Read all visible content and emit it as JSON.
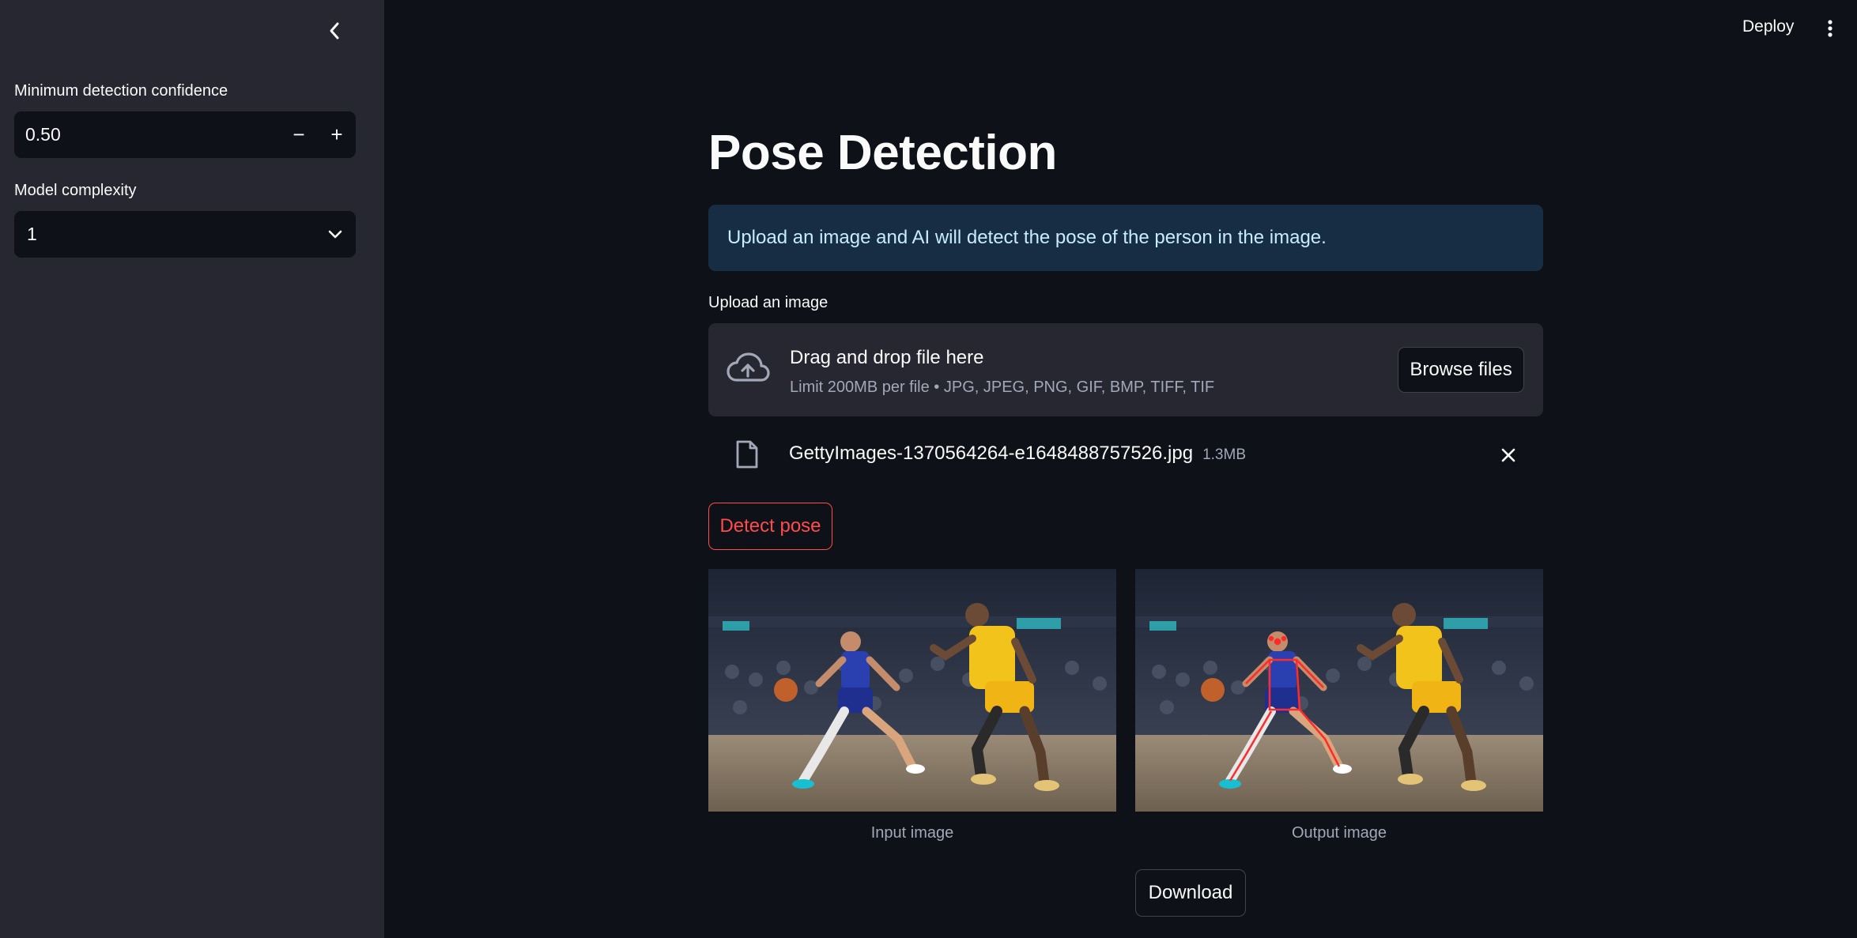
{
  "sidebar": {
    "confidence_label": "Minimum detection confidence",
    "confidence_value": "0.50",
    "decrement_symbol": "−",
    "increment_symbol": "+",
    "complexity_label": "Model complexity",
    "complexity_value": "1"
  },
  "header": {
    "deploy_label": "Deploy"
  },
  "main": {
    "title": "Pose Detection",
    "info_text": "Upload an image and AI will detect the pose of the person in the image.",
    "upload_label": "Upload an image",
    "dropzone_title": "Drag and drop file here",
    "dropzone_limit": "Limit 200MB per file • JPG, JPEG, PNG, GIF, BMP, TIFF, TIF",
    "browse_label": "Browse files",
    "file_name": "GettyImages-1370564264-e1648488757526.jpg",
    "file_size": "1.3MB",
    "detect_label": "Detect pose",
    "input_caption": "Input image",
    "output_caption": "Output image",
    "download_label": "Download"
  },
  "colors": {
    "app_bg": "#0e1117",
    "sidebar_bg": "#262730",
    "accent": "#ff4b4b",
    "info_bg": "#172d43",
    "info_text": "#c7ebff",
    "pose_overlay": "#ff2a2a"
  },
  "icons": {
    "collapse": "chevron-left-icon",
    "select": "chevron-down-icon",
    "menu": "kebab-menu-icon",
    "upload": "cloud-upload-icon",
    "file": "file-icon",
    "remove": "close-icon"
  }
}
